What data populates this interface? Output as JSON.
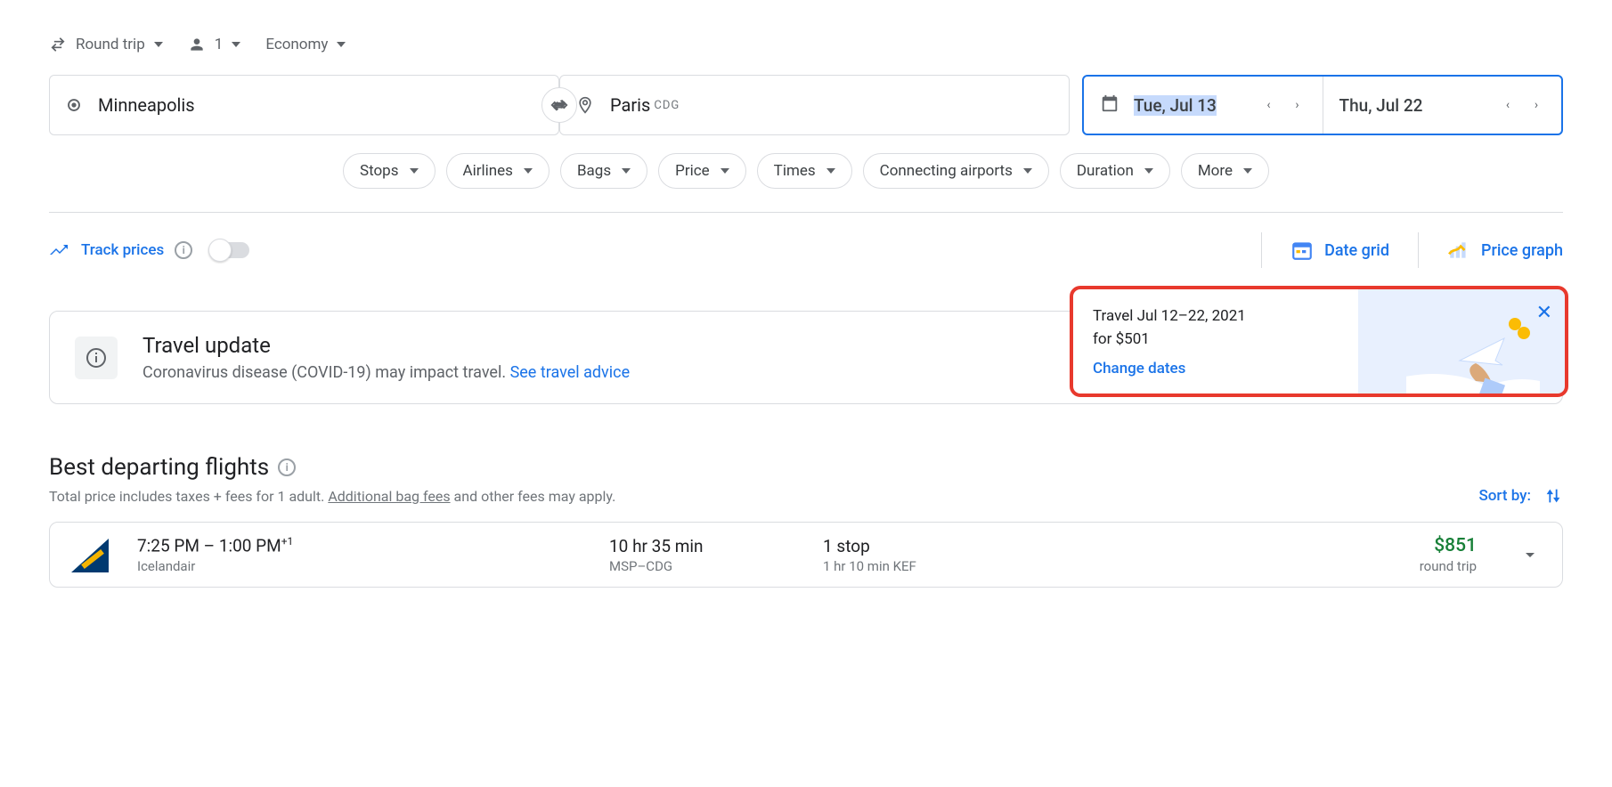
{
  "top": {
    "trip_type": "Round trip",
    "passengers": "1",
    "cabin": "Economy"
  },
  "search": {
    "origin": "Minneapolis",
    "destination": "Paris",
    "dest_code": "CDG",
    "depart_date": "Tue, Jul 13",
    "return_date": "Thu, Jul 22"
  },
  "filters": [
    "Stops",
    "Airlines",
    "Bags",
    "Price",
    "Times",
    "Connecting airports",
    "Duration",
    "More"
  ],
  "track": {
    "label": "Track prices",
    "date_grid": "Date grid",
    "price_graph": "Price graph"
  },
  "tip": {
    "line1": "Travel Jul 12–22, 2021",
    "line2": "for $501",
    "action": "Change dates"
  },
  "update": {
    "title": "Travel update",
    "text": "Coronavirus disease (COVID-19) may impact travel. ",
    "link": "See travel advice"
  },
  "section": {
    "title": "Best departing flights",
    "sub_pre": "Total price includes taxes + fees for 1 adult. ",
    "sub_link": "Additional bag fees",
    "sub_post": " and other fees may apply.",
    "sort_label": "Sort by:"
  },
  "flights": [
    {
      "times": "7:25 PM – 1:00 PM",
      "plus": "+1",
      "airline": "Icelandair",
      "duration": "10 hr 35 min",
      "route": "MSP–CDG",
      "stops": "1 stop",
      "layover": "1 hr 10 min KEF",
      "price": "$851",
      "price_sub": "round trip"
    }
  ]
}
